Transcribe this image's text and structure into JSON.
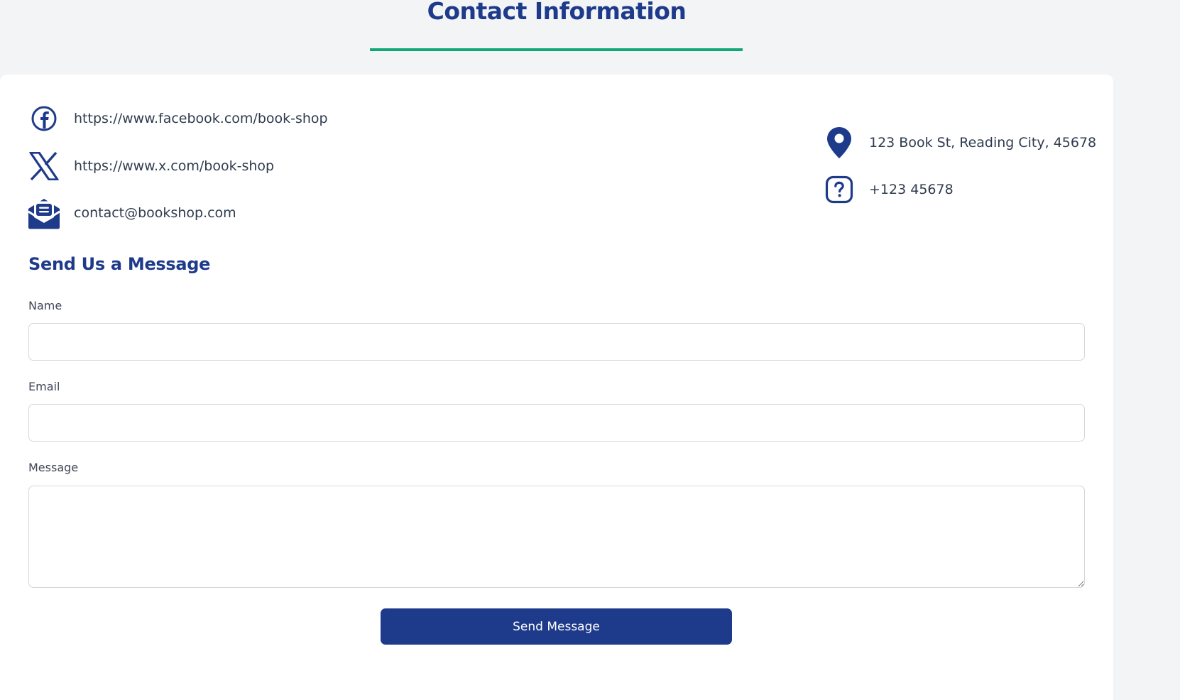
{
  "page": {
    "title": "Contact Information"
  },
  "contacts_left": [
    {
      "icon": "facebook-icon",
      "text": "https://www.facebook.com/book-shop"
    },
    {
      "icon": "x-icon",
      "text": "https://www.x.com/book-shop"
    },
    {
      "icon": "mail-icon",
      "text": "contact@bookshop.com"
    }
  ],
  "contacts_right": [
    {
      "icon": "location-pin-icon",
      "text": "123 Book St, Reading City, 45678"
    },
    {
      "icon": "question-icon",
      "text": "+123 45678"
    }
  ],
  "form": {
    "title": "Send Us a Message",
    "name_label": "Name",
    "name_value": "",
    "email_label": "Email",
    "email_value": "",
    "message_label": "Message",
    "message_value": "",
    "submit_label": "Send Message"
  },
  "colors": {
    "primary": "#1e3a8a",
    "accent": "#10a874",
    "background": "#f3f4f6",
    "card": "#ffffff"
  }
}
